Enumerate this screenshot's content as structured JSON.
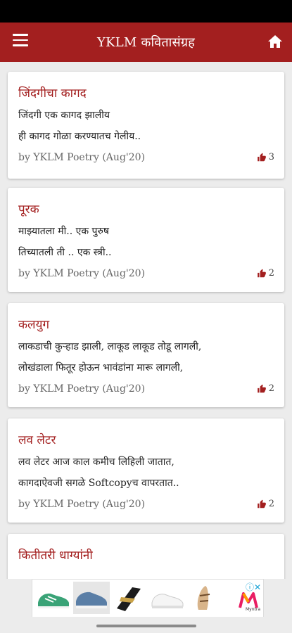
{
  "app_bar": {
    "title": "YKLM कवितासंग्रह",
    "menu_icon": "hamburger-menu-icon",
    "home_icon": "home-icon",
    "color": "#a31f1f"
  },
  "poems": [
    {
      "title": "जिंदगीचा कागद",
      "line1": "जिंदगी एक कागद झालीय",
      "line2": "ही कागद गोळा करण्यातच गेलीय..",
      "meta": "by YKLM Poetry (Aug'20)",
      "likes": "3"
    },
    {
      "title": "पूरक",
      "line1": "माझ्यातला मी.. एक पुरुष",
      "line2": "तिच्यातली ती .. एक स्त्री..",
      "meta": "by YKLM Poetry (Aug'20)",
      "likes": "2"
    },
    {
      "title": "कलयुग",
      "line1": "लाकडाची कुऱ्हाड झाली, लाकूड लाकूड तोडू लागली,",
      "line2": "लोखंडाला फितूर होऊन भावंडांना मारू लागली,",
      "meta": "by YKLM Poetry (Aug'20)",
      "likes": "2"
    },
    {
      "title": "लव लेटर",
      "line1": "लव लेटर आज काल कमीच लिहिली जातात,",
      "line2": "कागदाऐवजी सगळे Softcopyच वापरतात..",
      "meta": "by YKLM Poetry (Aug'20)",
      "likes": "2"
    },
    {
      "title": "कितीतरी धाग्यांनी",
      "line1": "",
      "line2": "",
      "meta": "",
      "likes": ""
    }
  ],
  "ad": {
    "items": [
      "green-sneaker",
      "blue-sneaker",
      "black-slide-sandal",
      "white-sneaker",
      "flat-sandal"
    ],
    "close_icon": "ad-choices-close-icon",
    "brand": "Myntra"
  },
  "like_icon": "thumbs-up-icon"
}
